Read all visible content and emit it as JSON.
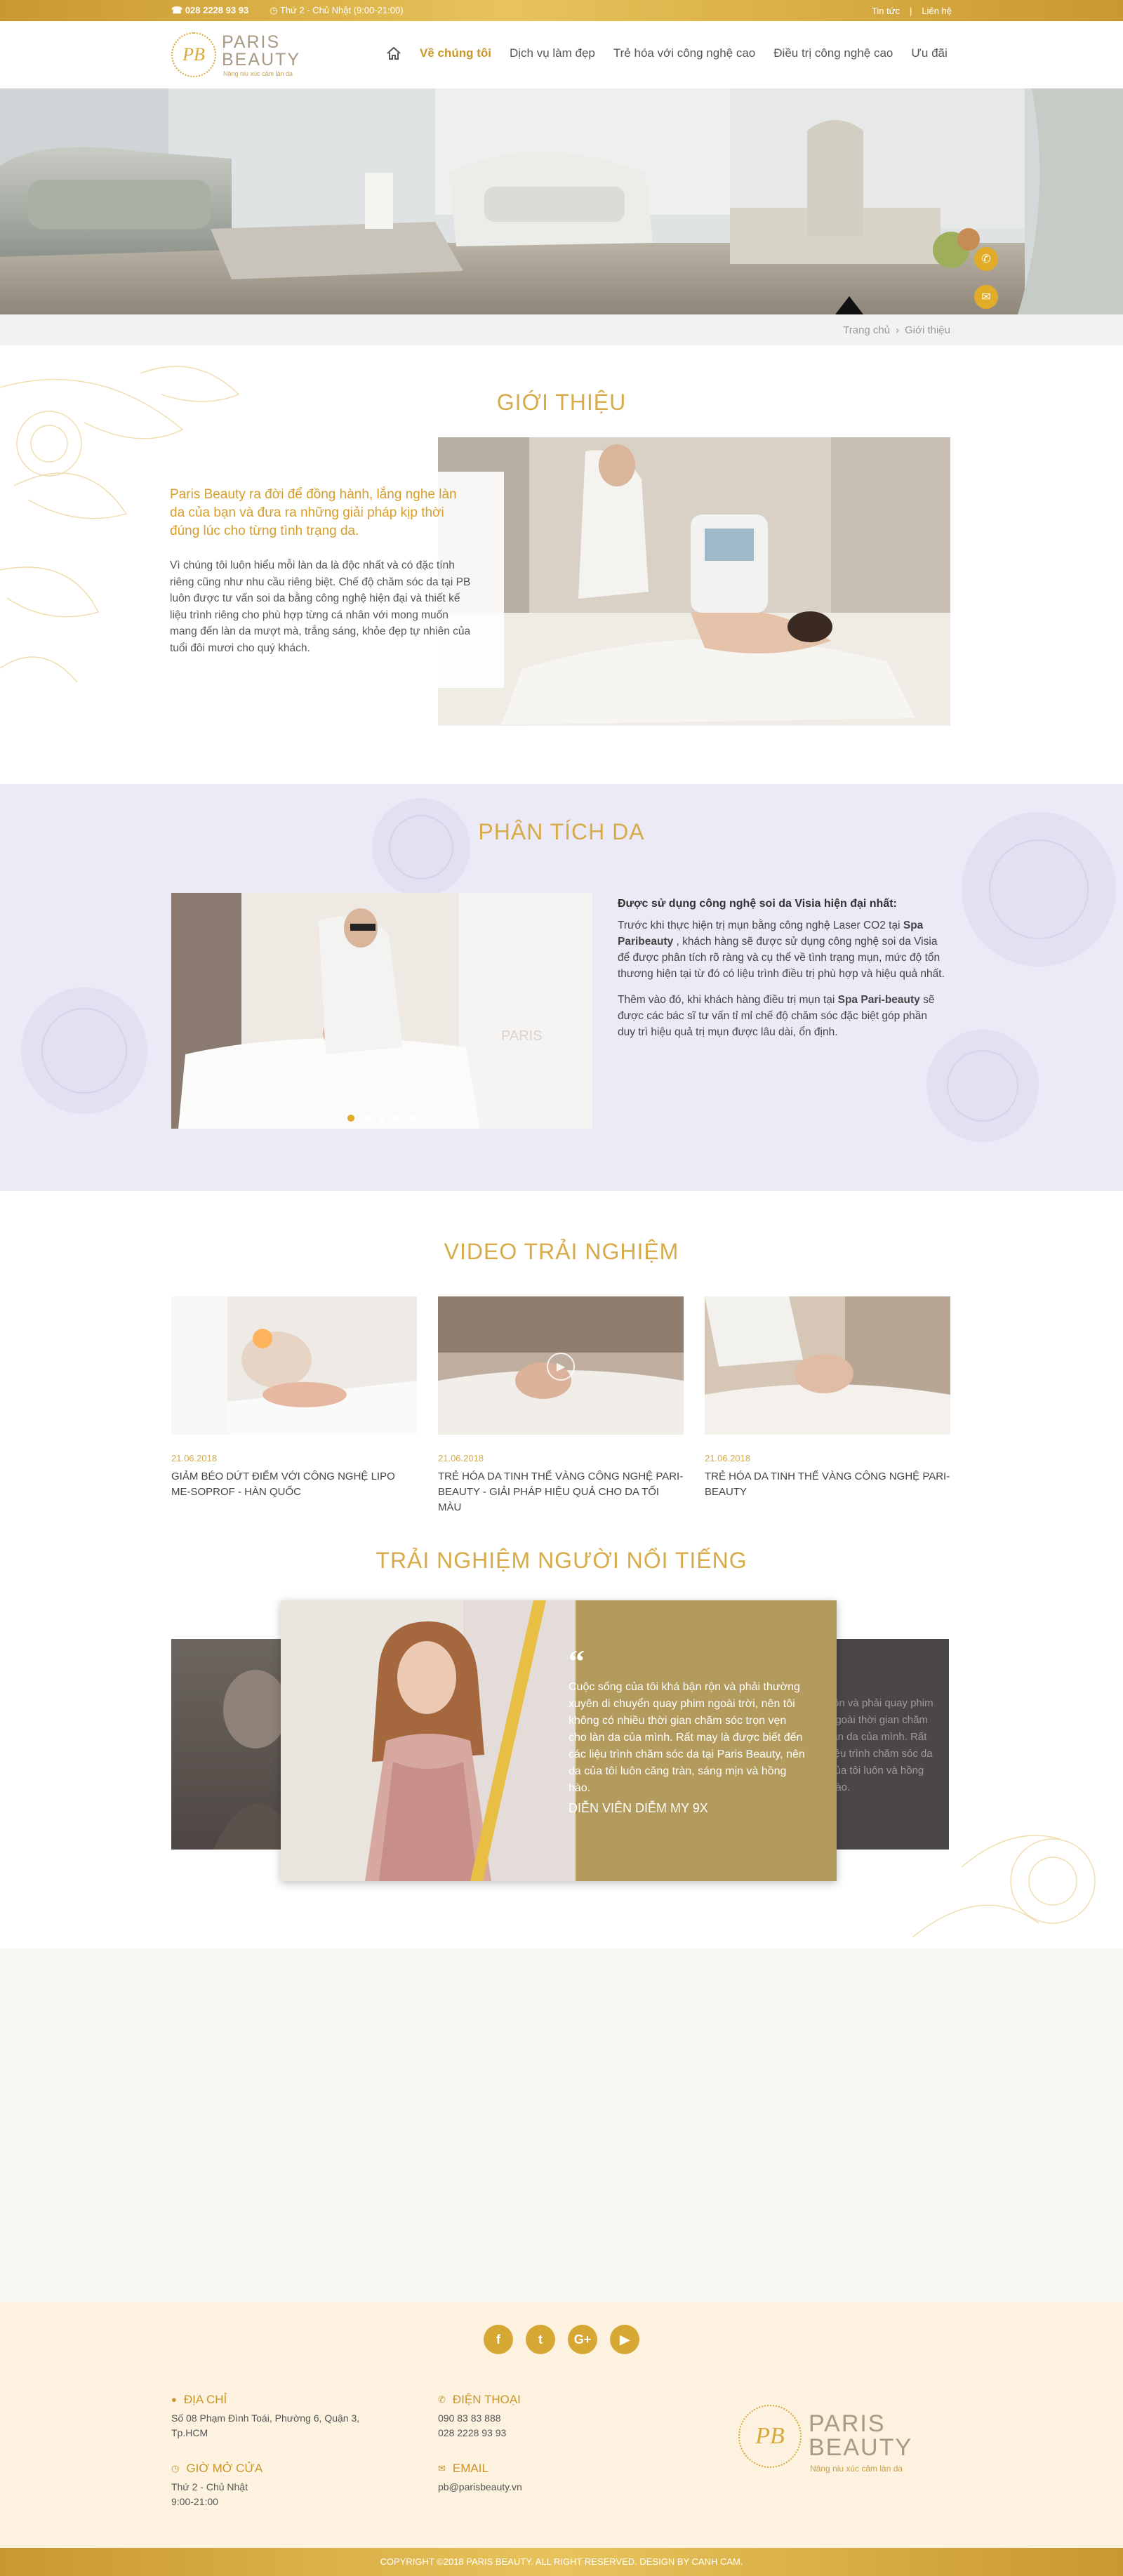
{
  "topbar": {
    "phone": "028 2228 93 93",
    "hours": "Thứ 2 - Chủ Nhật (9:00-21:00)",
    "links": [
      "Tin tức",
      "Liên hệ"
    ]
  },
  "logo": {
    "mark": "PB",
    "line1": "PARIS",
    "line2": "BEAUTY",
    "tagline": "Nâng niu xúc cảm làn da"
  },
  "nav": {
    "items": [
      "Về chúng tôi",
      "Dịch vụ làm đẹp",
      "Trẻ hóa với công nghệ cao",
      "Điều trị công nghệ cao",
      "Ưu đãi"
    ],
    "active_index": 0
  },
  "breadcrumb": [
    "Trang chủ",
    "Giới thiệu"
  ],
  "intro": {
    "title": "GIỚI THIỆU",
    "lead": "Paris Beauty ra đời để đồng hành, lắng nghe làn da của bạn và đưa ra những giải pháp kịp thời đúng lúc cho từng tình trạng da.",
    "body": "Vì chúng tôi luôn hiểu mỗi làn da là độc nhất và có đặc tính riêng cũng như nhu cầu riêng biệt. Chế độ chăm sóc da tại PB luôn được tư vấn soi da bằng công nghệ hiện đại và thiết kế liệu trình riêng cho phù hợp từng cá nhân với mong muốn mang đến làn da mượt mà, trắng sáng, khỏe đẹp tự nhiên của tuổi đôi mươi cho quý khách."
  },
  "skin": {
    "title": "PHÂN TÍCH DA",
    "heading": "Được sử dụng công nghệ soi da Visia hiện đại nhất:",
    "p1_a": "Trước khi thực hiện trị mụn bằng công nghệ Laser CO2 tại ",
    "p1_b": "Spa Paribeauty",
    "p1_c": " , khách hàng sẽ được sử dụng công nghệ soi da Visia để được phân tích rõ ràng và cụ thể về tình trạng mụn, mức độ tổn thương hiện tại từ đó có liệu trình điều trị phù hợp và hiệu quả nhất.",
    "p2_a": "Thêm vào đó, khi khách hàng điều trị mụn tại ",
    "p2_b": "Spa Pari-beauty",
    "p2_c": " sẽ được các bác sĩ tư vấn tỉ mỉ chế độ chăm sóc đặc biệt góp phần duy trì hiệu quả trị mụn được lâu dài, ổn định.",
    "slide_count": 5,
    "active_slide": 0
  },
  "videos": {
    "title": "VIDEO TRẢI NGHIỆM",
    "items": [
      {
        "date": "21.06.2018",
        "title": "GIẢM BÉO DỨT ĐIỂM VỚI CÔNG NGHỆ LIPO ME-SOPROF - HÀN QUỐC"
      },
      {
        "date": "21.06.2018",
        "title": "TRẺ HÓA DA TINH THỂ VÀNG CÔNG NGHỆ PARI-BEAUTY - GIẢI PHÁP HIỆU QUẢ CHO DA TỐI MÀU"
      },
      {
        "date": "21.06.2018",
        "title": "TRẺ HÓA DA TINH THỂ VÀNG CÔNG NGHỆ PARI-BEAUTY"
      }
    ]
  },
  "celebrity": {
    "title": "TRẢI NGHIỆM NGƯỜI NỔI TIẾNG",
    "quote_mark": "“",
    "quote": "Cuộc sống của tôi khá bận rộn và phải thường xuyên di chuyển quay phim ngoài trời, nên tôi không có nhiều thời gian chăm sóc trọn vẹn cho làn da của mình. Rất may là được biết đến các liệu trình chăm sóc da tại Paris Beauty, nên da của tôi luôn căng tràn, sáng mịn và hồng hào.",
    "name": "DIỄN VIÊN DIỄM MY 9X",
    "side_text": "rộn và phải quay phim ngoài thời gian chăm làn da của mình. Rất liệu trình chăm sóc da của tôi luôn và hồng hào."
  },
  "footer": {
    "social": [
      "f",
      "t",
      "G+",
      "▶"
    ],
    "address_label": "ĐỊA CHỈ",
    "address": "Số 08 Phạm Đình Toái, Phường 6, Quận 3, Tp.HCM",
    "phone_label": "ĐIỆN THOẠI",
    "phones": [
      "090 83 83 888",
      "028 2228 93 93"
    ],
    "hours_label": "GIỜ MỞ CỬA",
    "hours": [
      "Thứ 2 - Chủ Nhật",
      "9:00-21:00"
    ],
    "email_label": "EMAIL",
    "email": "pb@parisbeauty.vn",
    "copyright": "COPYRIGHT ©2018 PARIS BEAUTY. ALL RIGHT RESERVED. DESIGN BY CANH CAM."
  },
  "colors": {
    "gold": "#d7ab49",
    "accent": "#e2ab28",
    "lavender": "#eceaf7",
    "footer_bg": "#fcf2df"
  }
}
